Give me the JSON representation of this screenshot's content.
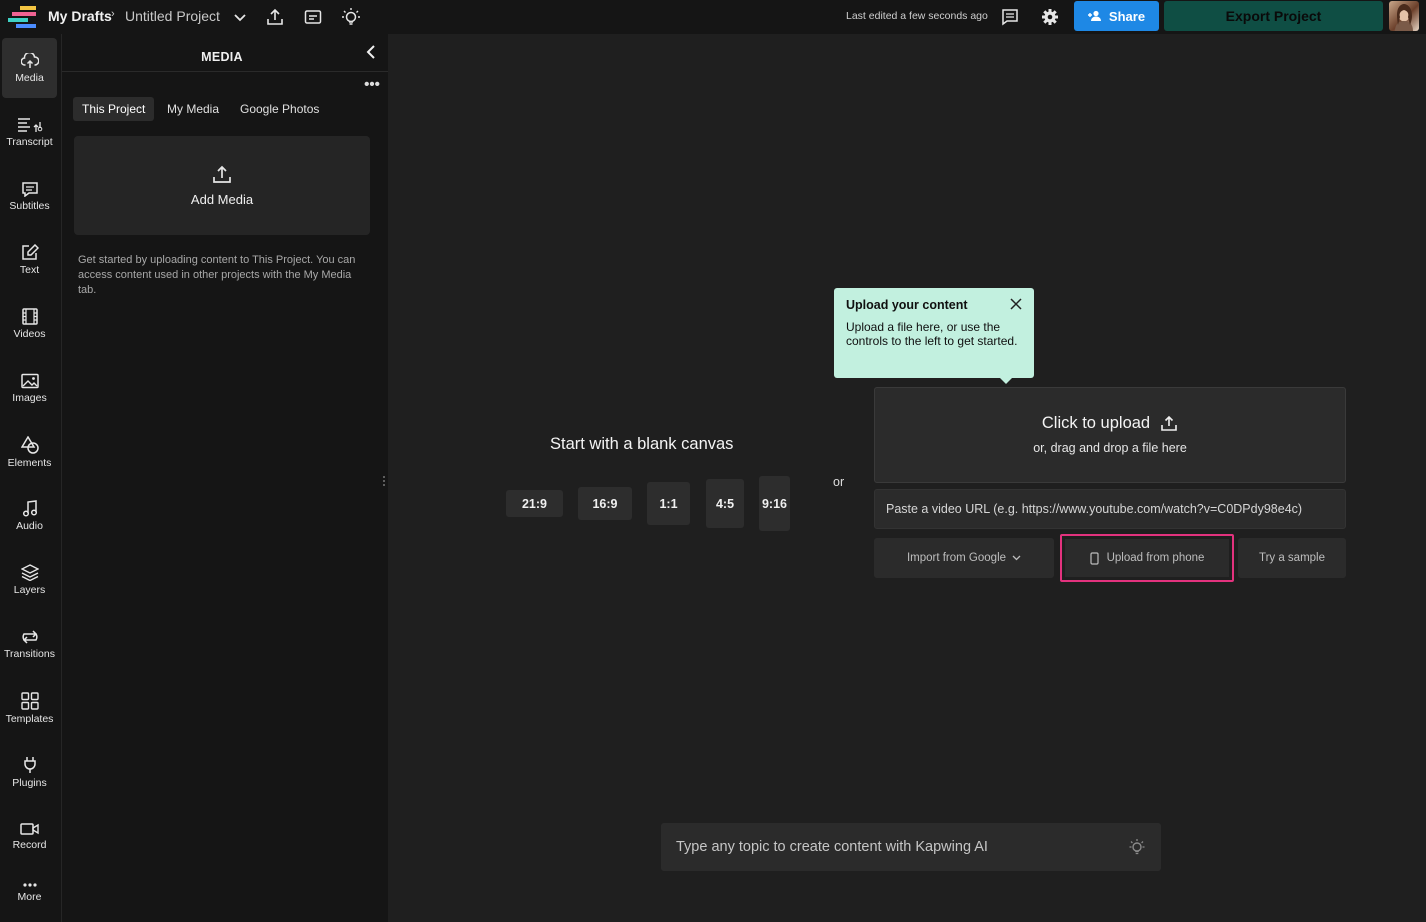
{
  "topbar": {
    "breadcrumb_root": "My Drafts",
    "breadcrumb_sep": "›",
    "project_name": "Untitled Project",
    "last_edited": "Last edited a few seconds ago",
    "share_label": "Share",
    "export_label": "Export Project",
    "colors": {
      "share": "#1e88e5",
      "export": "#0f4e44"
    },
    "icons": [
      "chevron-down-icon",
      "export-upload-icon",
      "captions-icon",
      "lightbulb-icon",
      "comment-icon",
      "gear-icon",
      "add-person-icon"
    ]
  },
  "rail": {
    "items": [
      {
        "label": "Media",
        "icon": "upload-cloud-icon",
        "active": true
      },
      {
        "label": "Transcript",
        "icon": "transcript-icon"
      },
      {
        "label": "Subtitles",
        "icon": "subtitles-icon"
      },
      {
        "label": "Text",
        "icon": "text-edit-icon"
      },
      {
        "label": "Videos",
        "icon": "film-icon"
      },
      {
        "label": "Images",
        "icon": "image-icon"
      },
      {
        "label": "Elements",
        "icon": "shapes-icon"
      },
      {
        "label": "Audio",
        "icon": "music-note-icon"
      },
      {
        "label": "Layers",
        "icon": "layers-icon"
      },
      {
        "label": "Transitions",
        "icon": "transition-icon"
      },
      {
        "label": "Templates",
        "icon": "templates-grid-icon"
      },
      {
        "label": "Plugins",
        "icon": "plug-icon"
      },
      {
        "label": "Record",
        "icon": "record-camera-icon"
      },
      {
        "label": "More",
        "icon": "more-dots-icon"
      }
    ]
  },
  "panel": {
    "title": "MEDIA",
    "more": "•••",
    "tabs": [
      {
        "label": "This Project",
        "active": true
      },
      {
        "label": "My Media"
      },
      {
        "label": "Google Photos"
      }
    ],
    "add_media_label": "Add Media",
    "help_text": "Get started by uploading content to This Project. You can access content used in other projects with the My Media tab."
  },
  "canvas": {
    "blank_title": "Start with a blank canvas",
    "ratios": [
      "21:9",
      "16:9",
      "1:1",
      "4:5",
      "9:16"
    ],
    "or": "or",
    "tooltip": {
      "title": "Upload your content",
      "body": "Upload a file here, or use the controls to the left to get started.",
      "bg": "#c2f0df"
    },
    "upload": {
      "main": "Click to upload",
      "sub": "or, drag and drop a file here"
    },
    "url_placeholder": "Paste a video URL (e.g. https://www.youtube.com/watch?v=C0DPdy98e4c)",
    "import_google": "Import from Google",
    "upload_phone": "Upload from phone",
    "try_sample": "Try a sample",
    "highlight_color": "#e3327e",
    "ai_placeholder": "Type any topic to create content with Kapwing AI"
  }
}
